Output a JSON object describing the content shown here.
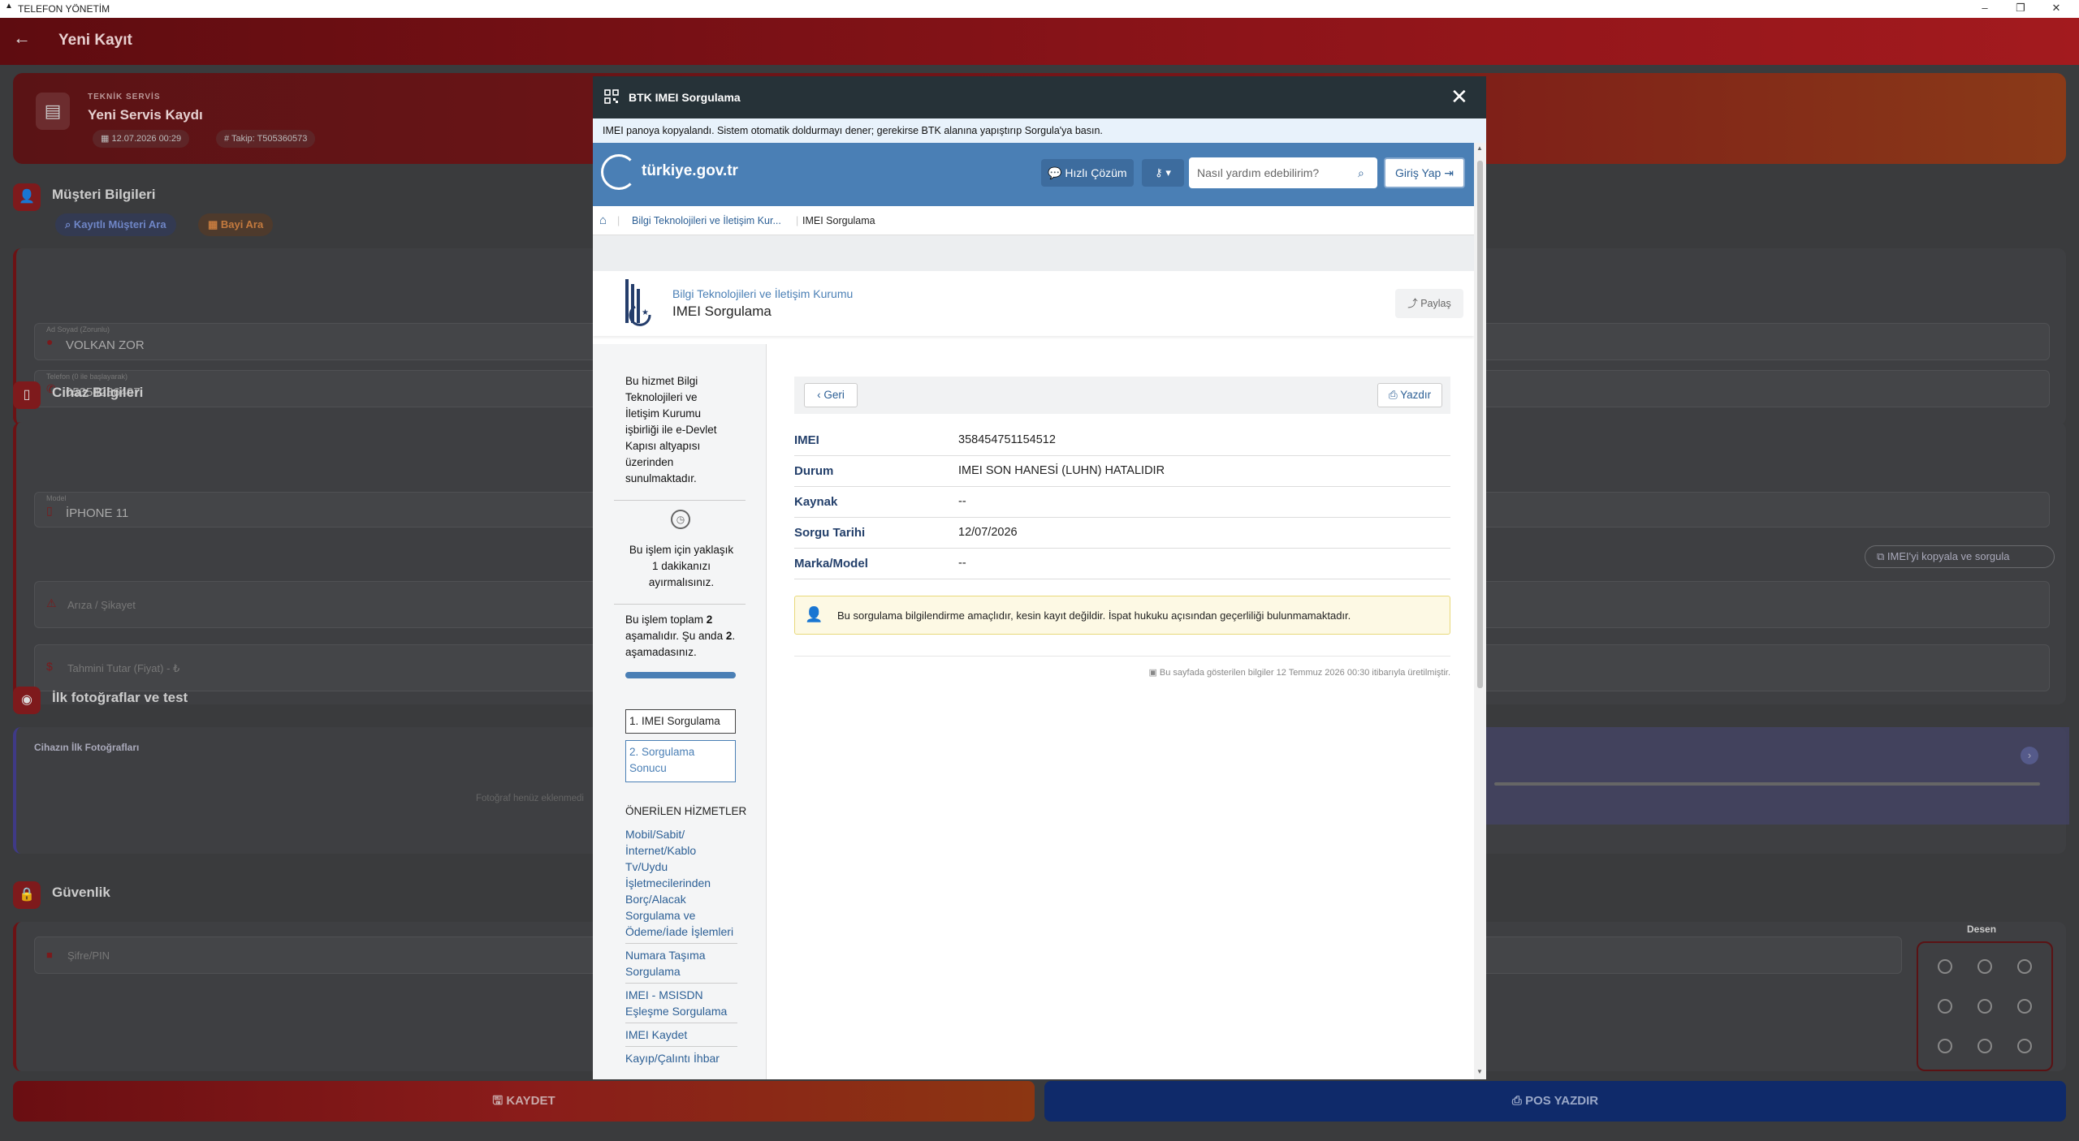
{
  "window": {
    "title": "TELEFON YÖNETİM"
  },
  "appbar": {
    "title": "Yeni Kayıt"
  },
  "hero": {
    "subtitle": "TEKNİK SERVİS",
    "title": "Yeni Servis Kaydı",
    "date": "12.07.2026 00:29",
    "tracking": "Takip: T505360573"
  },
  "customer": {
    "title": "Müşteri Bilgileri",
    "search_button": "Kayıtlı Müşteri Ara",
    "dealer_button": "Bayi Ara",
    "name_label": "Ad Soyad (Zorunlu)",
    "name_value": "VOLKAN ZOR",
    "phone_label": "Telefon (0 ile başlayarak)",
    "phone_value": "05354236497"
  },
  "device": {
    "title": "Cihaz Bilgileri",
    "model_label": "Model",
    "model_value": "İPHONE 11",
    "imei_copy_button": "IMEI'yi kopyala ve sorgula",
    "fault_placeholder": "Arıza / Şikayet",
    "price_placeholder": "Tahmini Tutar (Fiyat) - ₺"
  },
  "photos": {
    "title": "İlk fotoğraflar ve test",
    "subtitle": "Cihazın İlk Fotoğrafları",
    "empty": "Fotoğraf henüz eklenmedi"
  },
  "security": {
    "title": "Güvenlik",
    "pin_placeholder": "Şifre/PIN",
    "pattern_label": "Desen"
  },
  "bottom": {
    "save": "KAYDET",
    "pos": "POS YAZDIR"
  },
  "modal": {
    "title": "BTK IMEI Sorgulama",
    "info": "IMEI panoya kopyalandı. Sistem otomatik doldurmayı dener; gerekirse BTK alanına yapıştırıp Sorgula'ya basın.",
    "site": {
      "logo": "türkiye.gov.tr",
      "quick_solution": "Hızlı Çözüm",
      "search_placeholder": "Nasıl yardım edebilirim?",
      "login": "Giriş Yap",
      "breadcrumb": [
        "Bilgi Teknolojileri ve İletişim Kur...",
        "IMEI Sorgulama"
      ],
      "org": "Bilgi Teknolojileri ve İletişim Kurumu",
      "page_title": "IMEI Sorgulama",
      "share": "Paylaş",
      "sidebar": {
        "intro": [
          "Bu hizmet Bilgi",
          "Teknolojileri ve",
          "İletişim Kurumu",
          "işbirliği ile e-Devlet",
          "Kapısı altyapısı",
          "üzerinden",
          "sunulmaktadır."
        ],
        "time": [
          "Bu işlem için yaklaşık",
          "1 dakikanızı",
          "ayırmalısınız."
        ],
        "steps_text_a": "Bu işlem toplam ",
        "steps_total": "2",
        "steps_text_b": " aşamalıdır. Şu anda ",
        "steps_current": "2",
        "steps_text_c": ". aşamadasınız.",
        "progress": 1.0,
        "step1": "1. IMEI Sorgulama",
        "step2": "2. Sorgulama Sonucu",
        "suggested_title": "ÖNERİLEN HİZMETLER",
        "suggested": [
          "Mobil/Sabit/İnternet/Kablo Tv/Uydu İşletmecilerinden Borç/Alacak Sorgulama ve Ödeme/İade İşlemleri",
          "Numara Taşıma Sorgulama",
          "IMEI - MSISDN Eşleşme Sorgulama",
          "IMEI Kaydet",
          "Kayıp/Çalıntı İhbar"
        ]
      },
      "back": "Geri",
      "print": "Yazdır",
      "results": [
        {
          "key": "IMEI",
          "value": "358454751154512"
        },
        {
          "key": "Durum",
          "value": "IMEI SON HANESİ (LUHN) HATALIDIR"
        },
        {
          "key": "Kaynak",
          "value": "--"
        },
        {
          "key": "Sorgu Tarihi",
          "value": "12/07/2026"
        },
        {
          "key": "Marka/Model",
          "value": "--"
        }
      ],
      "notice": "Bu sorgulama bilgilendirme amaçlıdır, kesin kayıt değildir. İspat hukuku açısından geçerliliği bulunmamaktadır.",
      "footer": "Bu sayfada gösterilen bilgiler 12 Temmuz 2026 00:30 itibarıyla üretilmiştir."
    }
  },
  "colors": {
    "accent": "#8d1419",
    "gov_blue": "#4a7fb5",
    "link": "#2c5f95",
    "modal_header": "#263238"
  }
}
